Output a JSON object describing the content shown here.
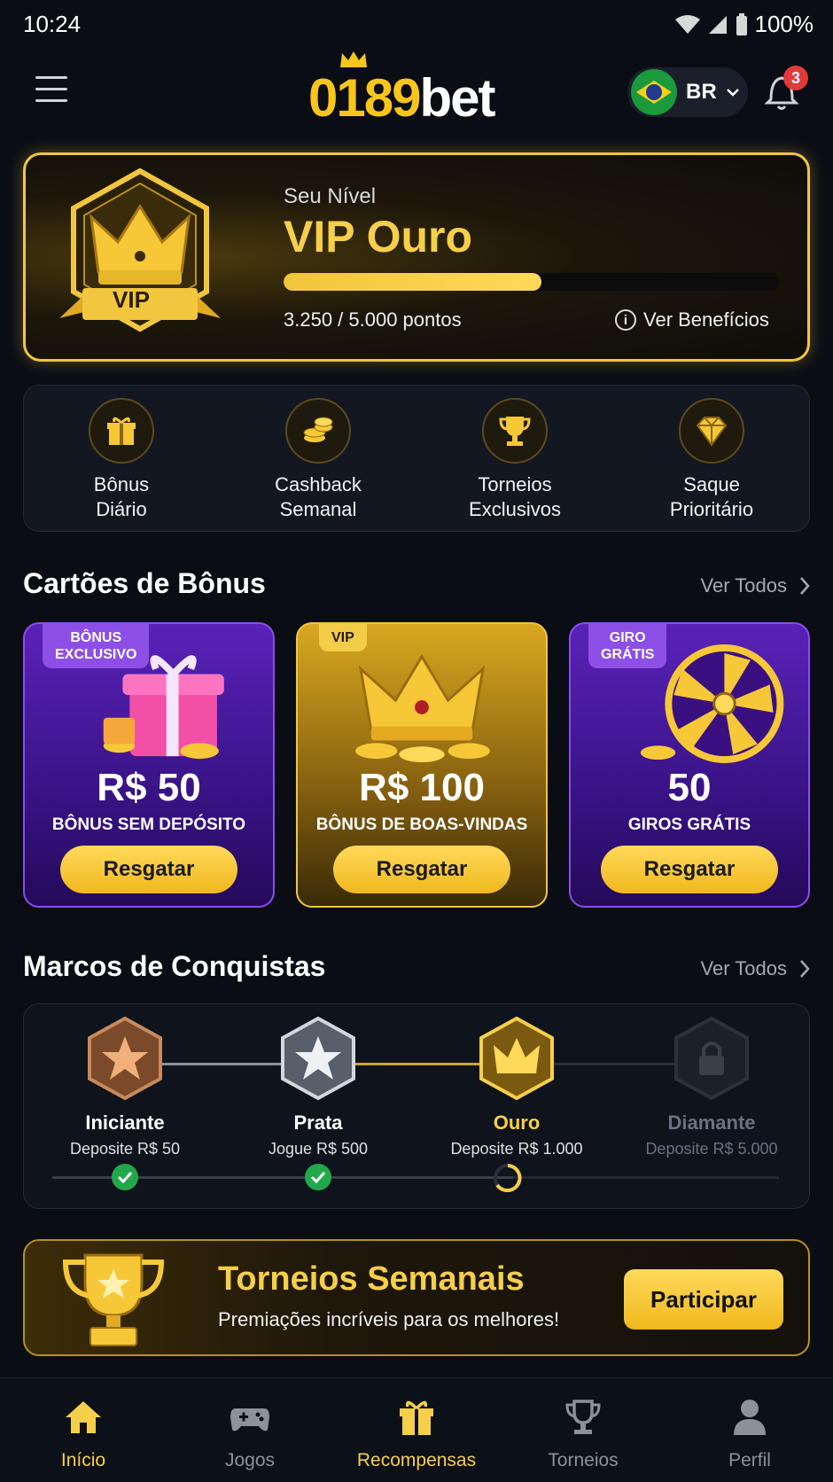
{
  "status_bar": {
    "time": "10:24",
    "battery": "100%"
  },
  "header": {
    "logo_number": "0189",
    "logo_word": "bet",
    "language": "BR",
    "notification_count": "3"
  },
  "vip": {
    "label": "Seu Nível",
    "level": "VIP Ouro",
    "badge_text": "VIP",
    "points": "3.250 / 5.000 pontos",
    "progress": 0.52,
    "benefits_label": "Ver Benefícios"
  },
  "perks": [
    {
      "line1": "Bônus",
      "line2": "Diário",
      "icon": "gift-icon"
    },
    {
      "line1": "Cashback",
      "line2": "Semanal",
      "icon": "coins-icon"
    },
    {
      "line1": "Torneios",
      "line2": "Exclusivos",
      "icon": "trophy-icon"
    },
    {
      "line1": "Saque",
      "line2": "Prioritário",
      "icon": "diamond-icon"
    }
  ],
  "bonus_section": {
    "title": "Cartões de Bônus",
    "see_all": "Ver Todos"
  },
  "bonus_cards": [
    {
      "tag1": "BÔNUS",
      "tag2": "EXCLUSIVO",
      "value": "R$ 50",
      "subtitle": "BÔNUS SEM DEPÓSITO",
      "button": "Resgatar"
    },
    {
      "tag1": "VIP",
      "tag2": "",
      "value": "R$ 100",
      "subtitle": "BÔNUS DE BOAS-VINDAS",
      "button": "Resgatar"
    },
    {
      "tag1": "GIRO",
      "tag2": "GRÁTIS",
      "value": "50",
      "subtitle": "GIROS GRÁTIS",
      "button": "Resgatar"
    }
  ],
  "milestones_section": {
    "title": "Marcos de Conquistas",
    "see_all": "Ver Todos"
  },
  "milestones": [
    {
      "name": "Iniciante",
      "requirement": "Deposite R$ 50",
      "state": "done"
    },
    {
      "name": "Prata",
      "requirement": "Jogue R$ 500",
      "state": "done"
    },
    {
      "name": "Ouro",
      "requirement": "Deposite R$ 1.000",
      "state": "active"
    },
    {
      "name": "Diamante",
      "requirement": "Deposite R$ 5.000",
      "state": "locked"
    }
  ],
  "tournament": {
    "title": "Torneios Semanais",
    "subtitle": "Premiações incríveis para os melhores!",
    "button": "Participar"
  },
  "nav": [
    {
      "label": "Início",
      "icon": "home-icon",
      "active": true
    },
    {
      "label": "Jogos",
      "icon": "gamepad-icon"
    },
    {
      "label": "Recompensas",
      "icon": "gift-icon"
    },
    {
      "label": "Torneios",
      "icon": "trophy-icon"
    },
    {
      "label": "Perfil",
      "icon": "user-icon"
    }
  ],
  "colors": {
    "accent": "#f6cf4a",
    "background": "#0a0d14",
    "purple": "#5a22b8",
    "success": "#22a84a"
  }
}
